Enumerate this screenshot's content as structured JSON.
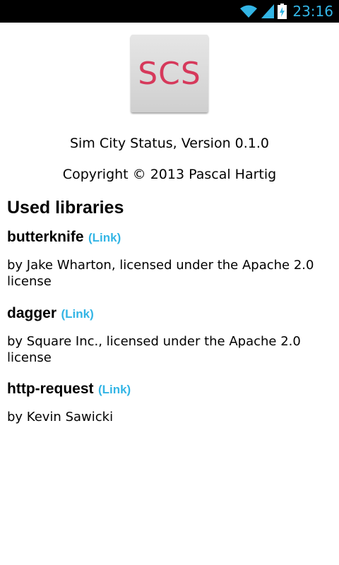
{
  "status_bar": {
    "time": "23:16",
    "icons": [
      "wifi-icon",
      "signal-icon",
      "battery-charging-icon"
    ],
    "time_color": "#33b5e5"
  },
  "about": {
    "logo_text": "SCS",
    "logo_color": "#d6395b",
    "app_line": "Sim City Status, Version 0.1.0",
    "copyright": "Copyright © 2013 Pascal Hartig"
  },
  "libraries": {
    "title": "Used libraries",
    "link_color": "#33b5e5",
    "items": [
      {
        "name": "butterknife",
        "link": "(Link)",
        "description": "by Jake Wharton, licensed under the Apache 2.0 license"
      },
      {
        "name": "dagger",
        "link": "(Link)",
        "description": "by Square Inc., licensed under the Apache 2.0 license"
      },
      {
        "name": "http-request",
        "link": "(Link)",
        "description": "by Kevin Sawicki"
      }
    ]
  }
}
